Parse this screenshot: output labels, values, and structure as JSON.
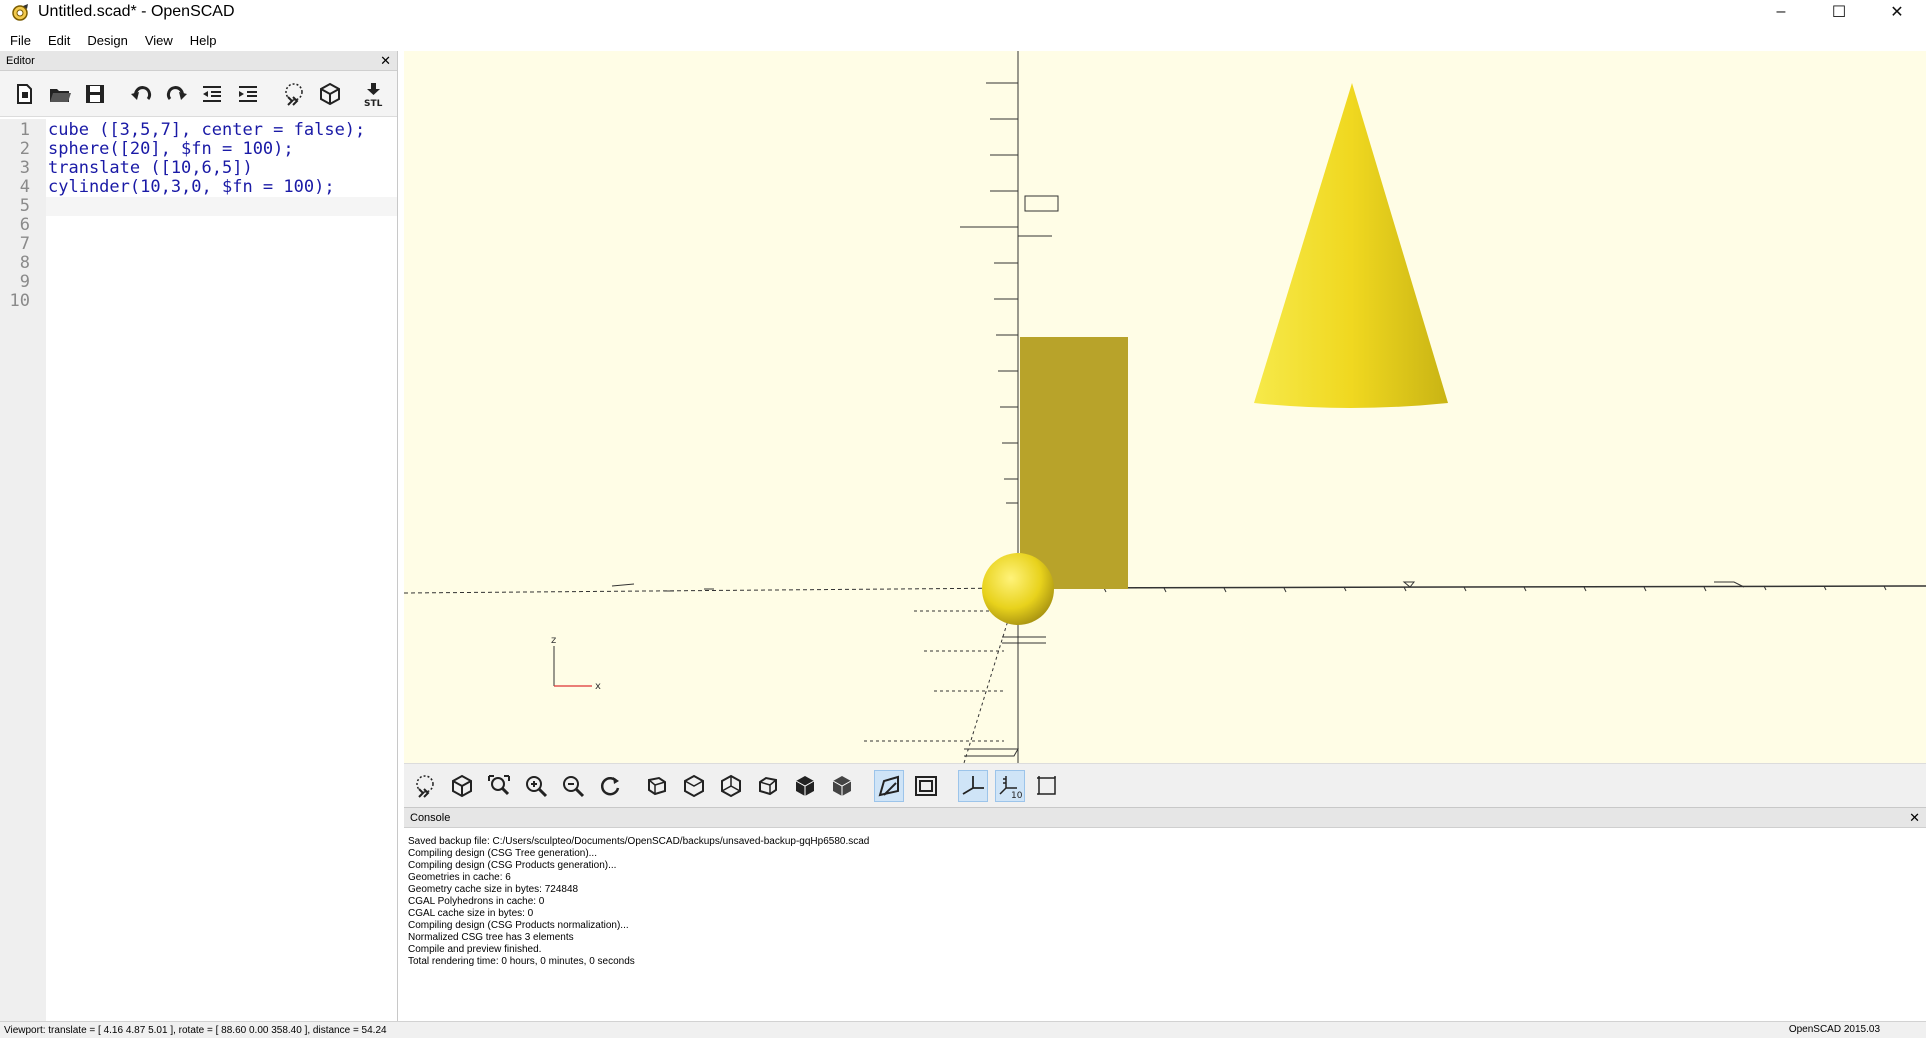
{
  "window": {
    "title": "Untitled.scad* - OpenSCAD",
    "controls": {
      "minimize": "–",
      "maximize": "☐",
      "close": "✕"
    }
  },
  "menu": [
    "File",
    "Edit",
    "Design",
    "View",
    "Help"
  ],
  "editor": {
    "title": "Editor",
    "toolbar_stl_label": "STL",
    "lines": [
      "cube ([3,5,7], center = false);",
      "sphere([20], $fn = 100);",
      "translate ([10,6,5])",
      "cylinder(10,3,0, $fn = 100);",
      "",
      "",
      "",
      "",
      "",
      ""
    ],
    "line_numbers": [
      "1",
      "2",
      "3",
      "4",
      "5",
      "6",
      "7",
      "8",
      "9",
      "10"
    ]
  },
  "viewport": {
    "axis_labels": {
      "z": "z",
      "x": "x"
    },
    "colors": {
      "background": "#fffde6",
      "object": "#f4e23a",
      "cube_front": "#b8a32a"
    }
  },
  "view_toolbar": {
    "scale_label": "10"
  },
  "console": {
    "title": "Console",
    "lines": [
      "Saved backup file: C:/Users/sculpteo/Documents/OpenSCAD/backups/unsaved-backup-gqHp6580.scad",
      "Compiling design (CSG Tree generation)...",
      "Compiling design (CSG Products generation)...",
      "Geometries in cache: 6",
      "Geometry cache size in bytes: 724848",
      "CGAL Polyhedrons in cache: 0",
      "CGAL cache size in bytes: 0",
      "Compiling design (CSG Products normalization)...",
      "Normalized CSG tree has 3 elements",
      "Compile and preview finished.",
      "Total rendering time: 0 hours, 0 minutes, 0 seconds"
    ]
  },
  "status": {
    "viewport": "Viewport: translate = [ 4.16 4.87 5.01 ], rotate = [ 88.60 0.00 358.40 ], distance = 54.24",
    "version": "OpenSCAD 2015.03"
  }
}
